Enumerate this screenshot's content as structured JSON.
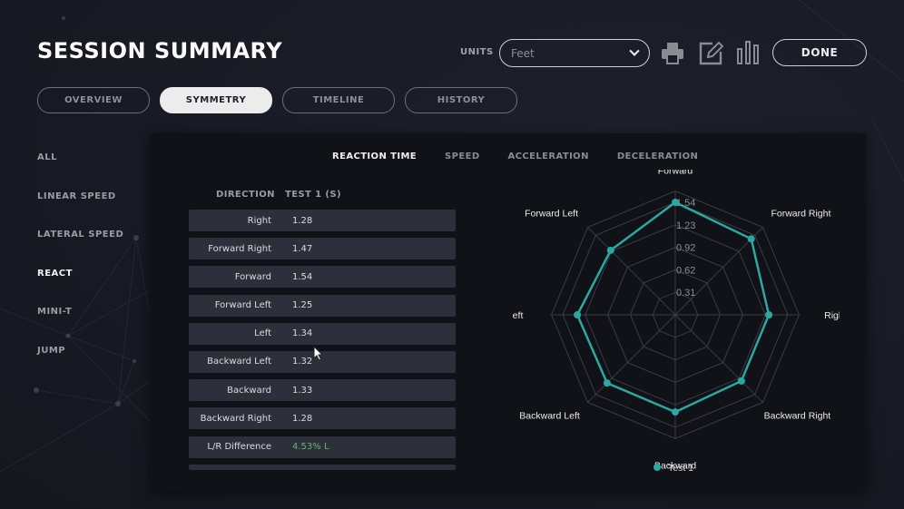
{
  "header": {
    "title": "SESSION SUMMARY",
    "units_label": "UNITS",
    "units_value": "Feet",
    "actions": [
      {
        "name": "print-icon",
        "icon": "printer"
      },
      {
        "name": "edit-icon",
        "icon": "pencil-square"
      },
      {
        "name": "chart-icon",
        "icon": "bar-chart"
      }
    ],
    "done_label": "DONE"
  },
  "tabs": [
    {
      "label": "OVERVIEW",
      "active": false
    },
    {
      "label": "SYMMETRY",
      "active": true
    },
    {
      "label": "TIMELINE",
      "active": false
    },
    {
      "label": "HISTORY",
      "active": false
    }
  ],
  "sidebar": {
    "items": [
      {
        "label": "ALL",
        "active": false
      },
      {
        "label": "LINEAR SPEED",
        "active": false
      },
      {
        "label": "LATERAL SPEED",
        "active": false
      },
      {
        "label": "REACT",
        "active": true
      },
      {
        "label": "MINI-T",
        "active": false
      },
      {
        "label": "JUMP",
        "active": false
      }
    ]
  },
  "metric_tabs": [
    {
      "label": "REACTION TIME",
      "active": true
    },
    {
      "label": "SPEED",
      "active": false
    },
    {
      "label": "ACCELERATION",
      "active": false
    },
    {
      "label": "DECELERATION",
      "active": false
    }
  ],
  "table": {
    "headers": [
      "DIRECTION",
      "TEST 1 (S)"
    ],
    "rows": [
      {
        "direction": "Right",
        "value": "1.28"
      },
      {
        "direction": "Forward Right",
        "value": "1.47"
      },
      {
        "direction": "Forward",
        "value": "1.54"
      },
      {
        "direction": "Forward Left",
        "value": "1.25"
      },
      {
        "direction": "Left",
        "value": "1.34"
      },
      {
        "direction": "Backward Left",
        "value": "1.32"
      },
      {
        "direction": "Backward",
        "value": "1.33"
      },
      {
        "direction": "Backward Right",
        "value": "1.28"
      },
      {
        "direction": "L/R Difference",
        "value": "4.53% L",
        "highlight": true
      }
    ]
  },
  "colors": {
    "series": "#2ba8a0",
    "positive": "#5fb865",
    "grid": "#3a3c45"
  },
  "chart_data": {
    "type": "radar",
    "axes": [
      "Forward",
      "Forward Right",
      "Right",
      "Backward Right",
      "Backward",
      "Backward Left",
      "Left",
      "Forward Left"
    ],
    "ticks": [
      "0.31",
      "0.62",
      "0.92",
      "1.23",
      "1.54"
    ],
    "range": [
      0,
      1.54
    ],
    "series": [
      {
        "name": "Test 1",
        "values": [
          1.54,
          1.47,
          1.28,
          1.28,
          1.33,
          1.32,
          1.34,
          1.25
        ]
      }
    ],
    "legend": "bottom"
  }
}
